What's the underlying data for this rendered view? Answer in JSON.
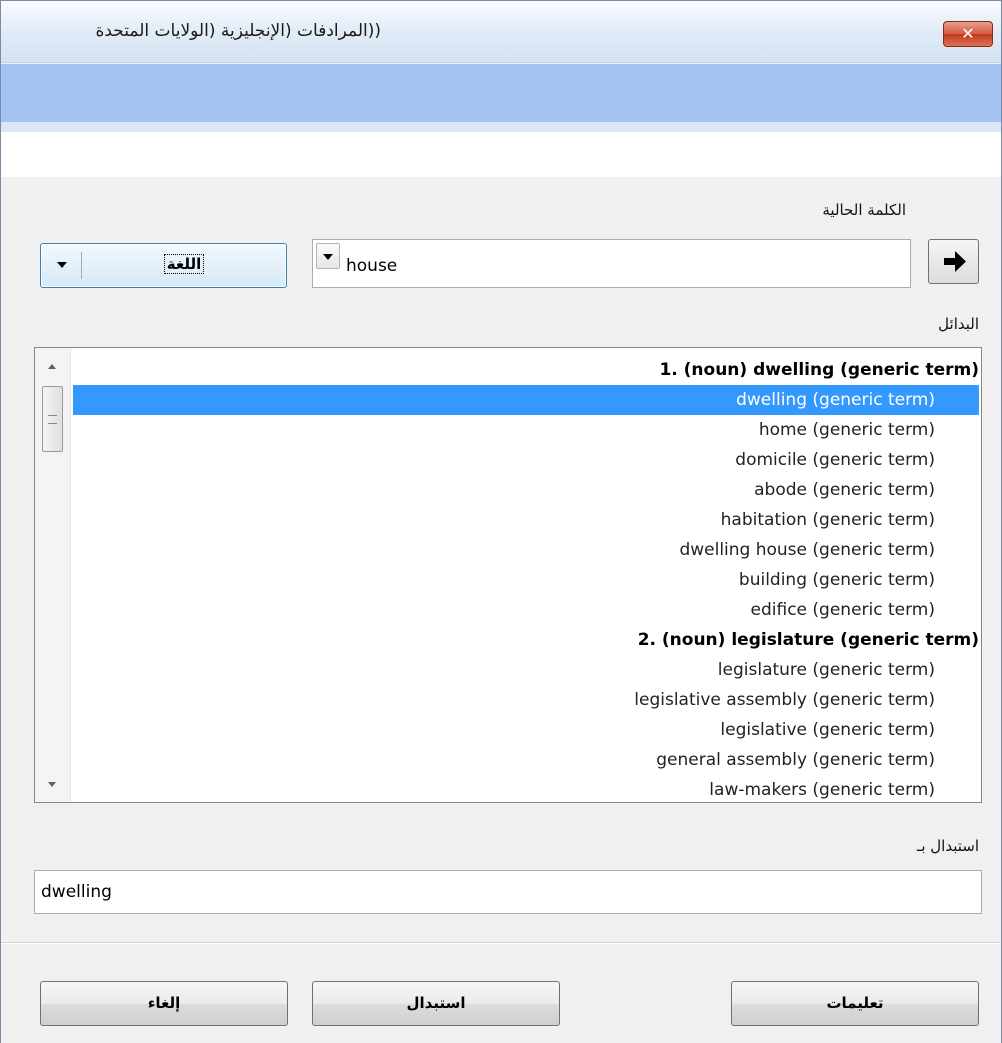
{
  "window": {
    "title": "((المرادفات (الإنجليزية (الولايات المتحدة",
    "close_label": "✕"
  },
  "current_word": {
    "label": "الكلمة الحالية",
    "value": "house",
    "language_button": "اللغة",
    "go_icon": "right-arrow-icon"
  },
  "alternatives": {
    "label": "البدائل",
    "items": [
      {
        "text": "1. (noun) dwelling (generic term)",
        "type": "heading"
      },
      {
        "text": "dwelling (generic term)",
        "type": "item",
        "selected": true
      },
      {
        "text": "home (generic term)",
        "type": "item"
      },
      {
        "text": "domicile (generic term)",
        "type": "item"
      },
      {
        "text": "abode (generic term)",
        "type": "item"
      },
      {
        "text": "habitation (generic term)",
        "type": "item"
      },
      {
        "text": "dwelling house (generic term)",
        "type": "item"
      },
      {
        "text": "building (generic term)",
        "type": "item"
      },
      {
        "text": "edifice (generic term)",
        "type": "item"
      },
      {
        "text": "2. (noun) legislature (generic term)",
        "type": "heading"
      },
      {
        "text": "legislature (generic term)",
        "type": "item"
      },
      {
        "text": "legislative assembly (generic term)",
        "type": "item"
      },
      {
        "text": "legislative (generic term)",
        "type": "item"
      },
      {
        "text": "general assembly (generic term)",
        "type": "item"
      },
      {
        "text": "law-makers (generic term)",
        "type": "item"
      }
    ]
  },
  "replace_with": {
    "label": "استبدال بـ",
    "value": "dwelling"
  },
  "buttons": {
    "help": "تعليمات",
    "replace": "استبدال",
    "cancel": "إلغاء"
  },
  "colors": {
    "selection": "#3399ff",
    "header_band": "#a4c3f2",
    "close_button": "#c3391c"
  }
}
